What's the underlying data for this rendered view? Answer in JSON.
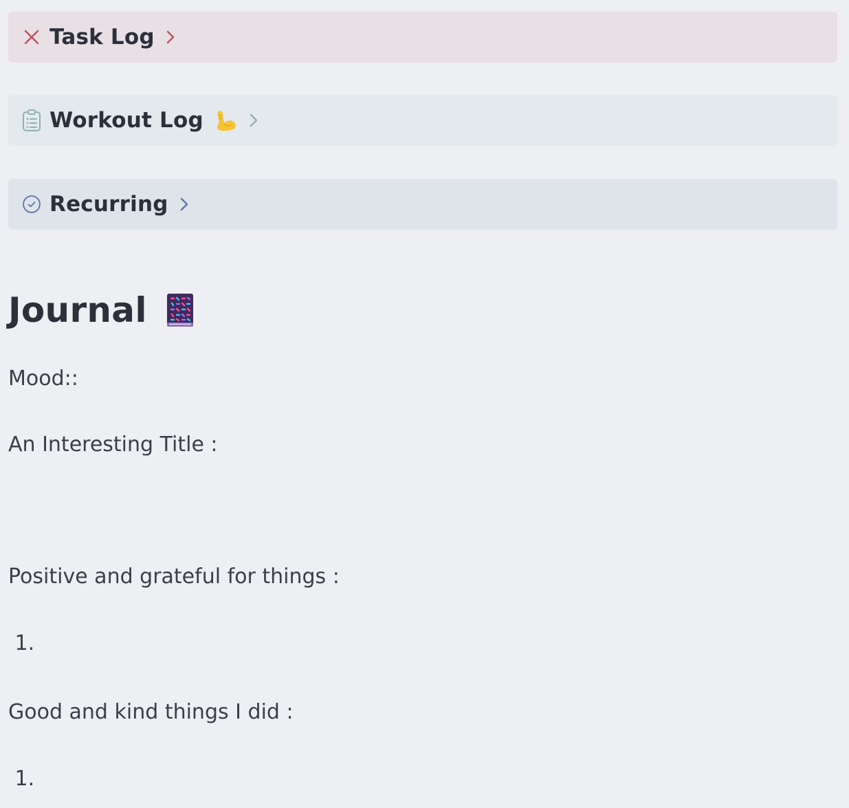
{
  "callouts": {
    "task_log": {
      "title": "Task Log",
      "icon": "x-icon",
      "color": "#c0505a"
    },
    "workout_log": {
      "title": "Workout Log",
      "icon": "clipboard-icon",
      "emoji": "flexed-biceps",
      "color": "#8fb3ac"
    },
    "recurring": {
      "title": "Recurring",
      "icon": "check-circle-icon",
      "color": "#5b76a6"
    }
  },
  "journal": {
    "heading": "Journal",
    "heading_emoji": "notebook-icon",
    "lines": {
      "mood": "Mood::",
      "title": "An Interesting Title :",
      "positive": "Positive and grateful for things :",
      "positive_item": " 1.",
      "good": "Good and kind things I did :",
      "good_item": " 1."
    }
  }
}
